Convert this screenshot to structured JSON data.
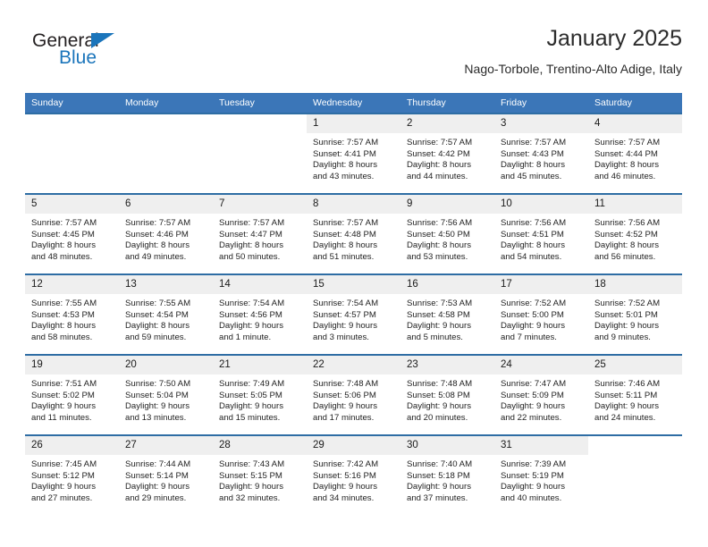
{
  "brand": {
    "name_part1": "General",
    "name_part2": "Blue",
    "triangle_color": "#1b75bb"
  },
  "header": {
    "title": "January 2025",
    "subtitle": "Nago-Torbole, Trentino-Alto Adige, Italy",
    "accent_color": "#3b76b8",
    "row_border_color": "#2e6da4",
    "daynum_band_color": "#efefef"
  },
  "calendar": {
    "weekday_headers": [
      "Sunday",
      "Monday",
      "Tuesday",
      "Wednesday",
      "Thursday",
      "Friday",
      "Saturday"
    ],
    "weeks": [
      [
        {
          "day": "",
          "sunrise": "",
          "sunset": "",
          "daylight1": "",
          "daylight2": "",
          "empty": true
        },
        {
          "day": "",
          "sunrise": "",
          "sunset": "",
          "daylight1": "",
          "daylight2": "",
          "empty": true
        },
        {
          "day": "",
          "sunrise": "",
          "sunset": "",
          "daylight1": "",
          "daylight2": "",
          "empty": true
        },
        {
          "day": "1",
          "sunrise": "Sunrise: 7:57 AM",
          "sunset": "Sunset: 4:41 PM",
          "daylight1": "Daylight: 8 hours",
          "daylight2": "and 43 minutes.",
          "empty": false
        },
        {
          "day": "2",
          "sunrise": "Sunrise: 7:57 AM",
          "sunset": "Sunset: 4:42 PM",
          "daylight1": "Daylight: 8 hours",
          "daylight2": "and 44 minutes.",
          "empty": false
        },
        {
          "day": "3",
          "sunrise": "Sunrise: 7:57 AM",
          "sunset": "Sunset: 4:43 PM",
          "daylight1": "Daylight: 8 hours",
          "daylight2": "and 45 minutes.",
          "empty": false
        },
        {
          "day": "4",
          "sunrise": "Sunrise: 7:57 AM",
          "sunset": "Sunset: 4:44 PM",
          "daylight1": "Daylight: 8 hours",
          "daylight2": "and 46 minutes.",
          "empty": false
        }
      ],
      [
        {
          "day": "5",
          "sunrise": "Sunrise: 7:57 AM",
          "sunset": "Sunset: 4:45 PM",
          "daylight1": "Daylight: 8 hours",
          "daylight2": "and 48 minutes.",
          "empty": false
        },
        {
          "day": "6",
          "sunrise": "Sunrise: 7:57 AM",
          "sunset": "Sunset: 4:46 PM",
          "daylight1": "Daylight: 8 hours",
          "daylight2": "and 49 minutes.",
          "empty": false
        },
        {
          "day": "7",
          "sunrise": "Sunrise: 7:57 AM",
          "sunset": "Sunset: 4:47 PM",
          "daylight1": "Daylight: 8 hours",
          "daylight2": "and 50 minutes.",
          "empty": false
        },
        {
          "day": "8",
          "sunrise": "Sunrise: 7:57 AM",
          "sunset": "Sunset: 4:48 PM",
          "daylight1": "Daylight: 8 hours",
          "daylight2": "and 51 minutes.",
          "empty": false
        },
        {
          "day": "9",
          "sunrise": "Sunrise: 7:56 AM",
          "sunset": "Sunset: 4:50 PM",
          "daylight1": "Daylight: 8 hours",
          "daylight2": "and 53 minutes.",
          "empty": false
        },
        {
          "day": "10",
          "sunrise": "Sunrise: 7:56 AM",
          "sunset": "Sunset: 4:51 PM",
          "daylight1": "Daylight: 8 hours",
          "daylight2": "and 54 minutes.",
          "empty": false
        },
        {
          "day": "11",
          "sunrise": "Sunrise: 7:56 AM",
          "sunset": "Sunset: 4:52 PM",
          "daylight1": "Daylight: 8 hours",
          "daylight2": "and 56 minutes.",
          "empty": false
        }
      ],
      [
        {
          "day": "12",
          "sunrise": "Sunrise: 7:55 AM",
          "sunset": "Sunset: 4:53 PM",
          "daylight1": "Daylight: 8 hours",
          "daylight2": "and 58 minutes.",
          "empty": false
        },
        {
          "day": "13",
          "sunrise": "Sunrise: 7:55 AM",
          "sunset": "Sunset: 4:54 PM",
          "daylight1": "Daylight: 8 hours",
          "daylight2": "and 59 minutes.",
          "empty": false
        },
        {
          "day": "14",
          "sunrise": "Sunrise: 7:54 AM",
          "sunset": "Sunset: 4:56 PM",
          "daylight1": "Daylight: 9 hours",
          "daylight2": "and 1 minute.",
          "empty": false
        },
        {
          "day": "15",
          "sunrise": "Sunrise: 7:54 AM",
          "sunset": "Sunset: 4:57 PM",
          "daylight1": "Daylight: 9 hours",
          "daylight2": "and 3 minutes.",
          "empty": false
        },
        {
          "day": "16",
          "sunrise": "Sunrise: 7:53 AM",
          "sunset": "Sunset: 4:58 PM",
          "daylight1": "Daylight: 9 hours",
          "daylight2": "and 5 minutes.",
          "empty": false
        },
        {
          "day": "17",
          "sunrise": "Sunrise: 7:52 AM",
          "sunset": "Sunset: 5:00 PM",
          "daylight1": "Daylight: 9 hours",
          "daylight2": "and 7 minutes.",
          "empty": false
        },
        {
          "day": "18",
          "sunrise": "Sunrise: 7:52 AM",
          "sunset": "Sunset: 5:01 PM",
          "daylight1": "Daylight: 9 hours",
          "daylight2": "and 9 minutes.",
          "empty": false
        }
      ],
      [
        {
          "day": "19",
          "sunrise": "Sunrise: 7:51 AM",
          "sunset": "Sunset: 5:02 PM",
          "daylight1": "Daylight: 9 hours",
          "daylight2": "and 11 minutes.",
          "empty": false
        },
        {
          "day": "20",
          "sunrise": "Sunrise: 7:50 AM",
          "sunset": "Sunset: 5:04 PM",
          "daylight1": "Daylight: 9 hours",
          "daylight2": "and 13 minutes.",
          "empty": false
        },
        {
          "day": "21",
          "sunrise": "Sunrise: 7:49 AM",
          "sunset": "Sunset: 5:05 PM",
          "daylight1": "Daylight: 9 hours",
          "daylight2": "and 15 minutes.",
          "empty": false
        },
        {
          "day": "22",
          "sunrise": "Sunrise: 7:48 AM",
          "sunset": "Sunset: 5:06 PM",
          "daylight1": "Daylight: 9 hours",
          "daylight2": "and 17 minutes.",
          "empty": false
        },
        {
          "day": "23",
          "sunrise": "Sunrise: 7:48 AM",
          "sunset": "Sunset: 5:08 PM",
          "daylight1": "Daylight: 9 hours",
          "daylight2": "and 20 minutes.",
          "empty": false
        },
        {
          "day": "24",
          "sunrise": "Sunrise: 7:47 AM",
          "sunset": "Sunset: 5:09 PM",
          "daylight1": "Daylight: 9 hours",
          "daylight2": "and 22 minutes.",
          "empty": false
        },
        {
          "day": "25",
          "sunrise": "Sunrise: 7:46 AM",
          "sunset": "Sunset: 5:11 PM",
          "daylight1": "Daylight: 9 hours",
          "daylight2": "and 24 minutes.",
          "empty": false
        }
      ],
      [
        {
          "day": "26",
          "sunrise": "Sunrise: 7:45 AM",
          "sunset": "Sunset: 5:12 PM",
          "daylight1": "Daylight: 9 hours",
          "daylight2": "and 27 minutes.",
          "empty": false
        },
        {
          "day": "27",
          "sunrise": "Sunrise: 7:44 AM",
          "sunset": "Sunset: 5:14 PM",
          "daylight1": "Daylight: 9 hours",
          "daylight2": "and 29 minutes.",
          "empty": false
        },
        {
          "day": "28",
          "sunrise": "Sunrise: 7:43 AM",
          "sunset": "Sunset: 5:15 PM",
          "daylight1": "Daylight: 9 hours",
          "daylight2": "and 32 minutes.",
          "empty": false
        },
        {
          "day": "29",
          "sunrise": "Sunrise: 7:42 AM",
          "sunset": "Sunset: 5:16 PM",
          "daylight1": "Daylight: 9 hours",
          "daylight2": "and 34 minutes.",
          "empty": false
        },
        {
          "day": "30",
          "sunrise": "Sunrise: 7:40 AM",
          "sunset": "Sunset: 5:18 PM",
          "daylight1": "Daylight: 9 hours",
          "daylight2": "and 37 minutes.",
          "empty": false
        },
        {
          "day": "31",
          "sunrise": "Sunrise: 7:39 AM",
          "sunset": "Sunset: 5:19 PM",
          "daylight1": "Daylight: 9 hours",
          "daylight2": "and 40 minutes.",
          "empty": false
        },
        {
          "day": "",
          "sunrise": "",
          "sunset": "",
          "daylight1": "",
          "daylight2": "",
          "empty": true
        }
      ]
    ]
  }
}
